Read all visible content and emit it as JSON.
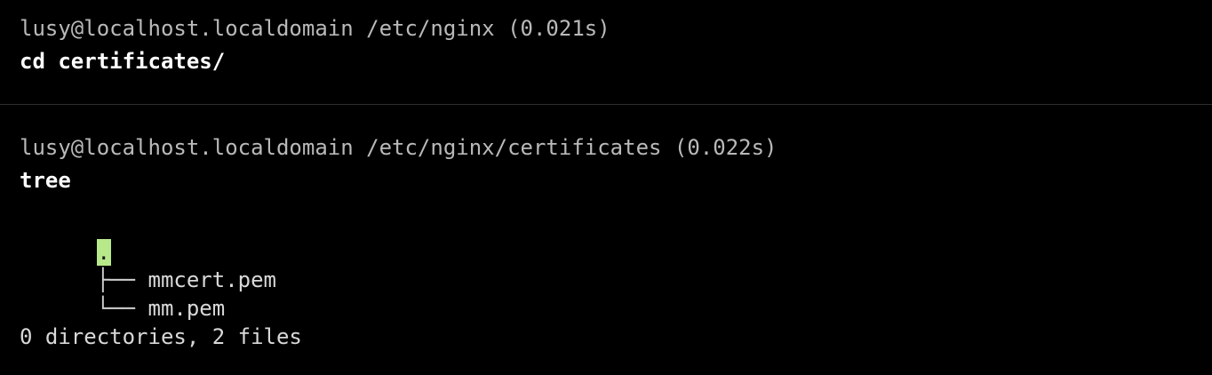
{
  "blocks": [
    {
      "prompt": "lusy@localhost.localdomain /etc/nginx (0.021s)",
      "command": "cd certificates/"
    },
    {
      "prompt": "lusy@localhost.localdomain /etc/nginx/certificates (0.022s)",
      "command": "tree",
      "output": {
        "root": ".",
        "entries": [
          {
            "branch": "├── ",
            "name": "mmcert.pem"
          },
          {
            "branch": "└── ",
            "name": "mm.pem"
          }
        ],
        "summary": "0 directories, 2 files"
      }
    }
  ],
  "colors": {
    "background": "#000000",
    "prompt": "#b9b9b9",
    "command": "#ffffff",
    "cursor_highlight": "#b7e88a",
    "divider": "#2e2e2e"
  }
}
